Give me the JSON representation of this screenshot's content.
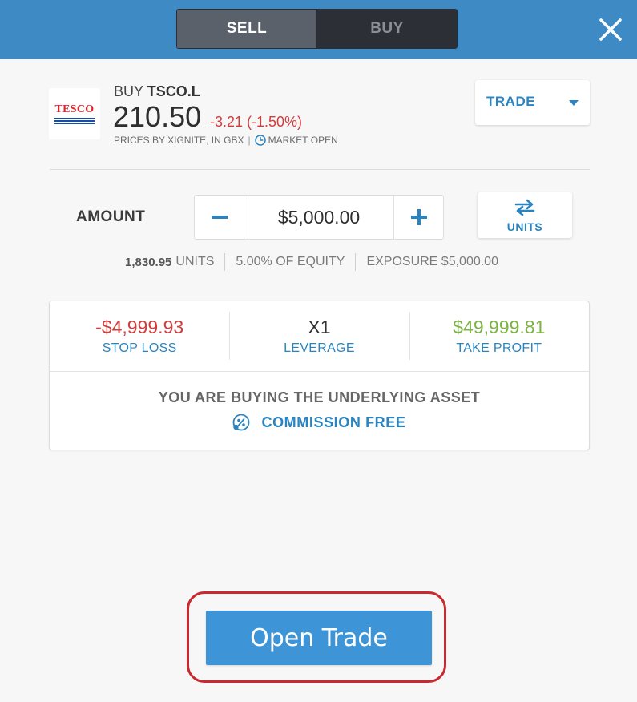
{
  "header": {
    "sell_label": "SELL",
    "buy_label": "BUY",
    "active_tab": "SELL"
  },
  "instrument": {
    "logo_text": "TESCO",
    "action": "BUY",
    "symbol": "TSCO.L",
    "price": "210.50",
    "change": "-3.21 (-1.50%)",
    "prices_by": "PRICES BY XIGNITE, IN GBX",
    "market_status": "MARKET OPEN"
  },
  "order_type": {
    "label": "TRADE"
  },
  "amount": {
    "label": "AMOUNT",
    "value": "$5,000.00",
    "minus": "−",
    "plus": "+",
    "toggle_label": "UNITS"
  },
  "summary": {
    "units_value": "1,830.95",
    "units_label": "UNITS",
    "equity": "5.00% OF EQUITY",
    "exposure": "EXPOSURE $5,000.00"
  },
  "risk": {
    "stop_loss_value": "-$4,999.93",
    "stop_loss_label": "STOP LOSS",
    "leverage_value": "X1",
    "leverage_label": "LEVERAGE",
    "take_profit_value": "$49,999.81",
    "take_profit_label": "TAKE PROFIT"
  },
  "notice": {
    "underlying": "YOU ARE BUYING THE UNDERLYING ASSET",
    "commission": "COMMISSION FREE"
  },
  "cta": {
    "open_trade": "Open Trade"
  },
  "colors": {
    "header_blue": "#3d8ac4",
    "accent_blue": "#2a84c0",
    "loss_red": "#d33c3c",
    "profit_green": "#7cb342",
    "button_blue": "#3d95d7",
    "highlight_red": "#c8282e"
  },
  "icons": {
    "close": "close-icon",
    "clock": "clock-icon",
    "caret": "caret-down-icon",
    "swap": "swap-arrows-icon",
    "commission": "percent-badge-icon"
  }
}
